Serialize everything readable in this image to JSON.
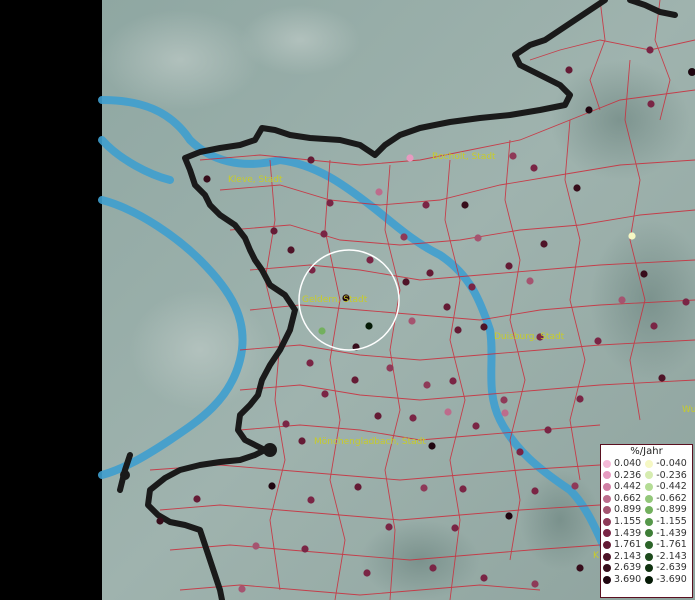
{
  "map": {
    "cities": [
      {
        "name": "Kleve, Stadt"
      },
      {
        "name": "Bocholt, Stadt"
      },
      {
        "name": "Geldern, Stadt"
      },
      {
        "name": "Duisburg, Stadt"
      },
      {
        "name": "Mönchengladbach, Stadt"
      },
      {
        "name": "Wu"
      },
      {
        "name": "K"
      }
    ]
  },
  "legend": {
    "title": "%/Jahr",
    "positive": [
      {
        "value": "0.040",
        "color": "#f4b8d6"
      },
      {
        "value": "0.236",
        "color": "#e79ac0"
      },
      {
        "value": "0.442",
        "color": "#d17fa4"
      },
      {
        "value": "0.662",
        "color": "#bd6c8c"
      },
      {
        "value": "0.899",
        "color": "#a55470"
      },
      {
        "value": "1.155",
        "color": "#8e3a58"
      },
      {
        "value": "1.439",
        "color": "#7a2545"
      },
      {
        "value": "1.761",
        "color": "#651b35"
      },
      {
        "value": "2.143",
        "color": "#4f1428"
      },
      {
        "value": "2.639",
        "color": "#370d1b"
      },
      {
        "value": "3.690",
        "color": "#200610"
      }
    ],
    "negative": [
      {
        "value": "-0.040",
        "color": "#f6f8c4"
      },
      {
        "value": "-0.236",
        "color": "#d6ecb0"
      },
      {
        "value": "-0.442",
        "color": "#b4dc95"
      },
      {
        "value": "-0.662",
        "color": "#93c77a"
      },
      {
        "value": "-0.899",
        "color": "#73b05e"
      },
      {
        "value": "-1.155",
        "color": "#56984a"
      },
      {
        "value": "-1.439",
        "color": "#3e7e37"
      },
      {
        "value": "-1.761",
        "color": "#2c6429"
      },
      {
        "value": "-2.143",
        "color": "#1d4a1c"
      },
      {
        "value": "-2.639",
        "color": "#103310"
      },
      {
        "value": "-3.690",
        "color": "#051a06"
      }
    ]
  }
}
